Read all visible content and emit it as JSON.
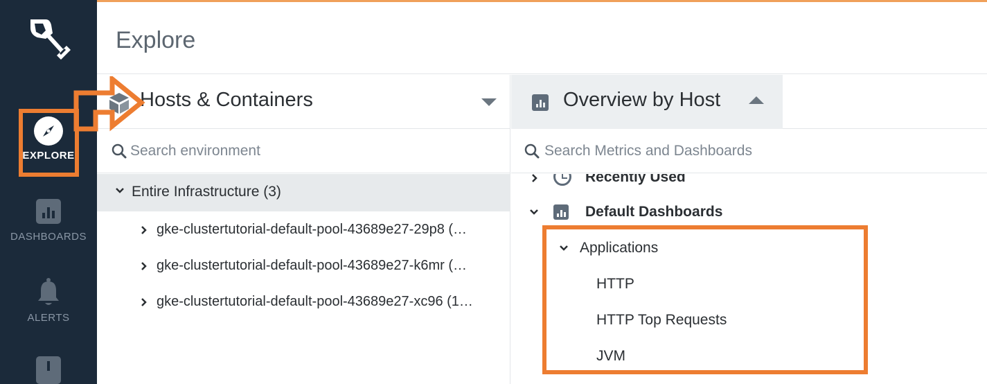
{
  "page": {
    "title": "Explore"
  },
  "sidebar": {
    "items": [
      {
        "label": "EXPLORE",
        "icon": "compass-icon",
        "active": true
      },
      {
        "label": "DASHBOARDS",
        "icon": "dashboard-icon",
        "active": false
      },
      {
        "label": "ALERTS",
        "icon": "bell-icon",
        "active": false
      },
      {
        "label": "",
        "icon": "alert-square-icon",
        "active": false
      }
    ]
  },
  "hosts_panel": {
    "title": "Hosts & Containers",
    "search_placeholder": "Search environment",
    "root": {
      "label": "Entire Infrastructure (3)"
    },
    "nodes": [
      {
        "label": "gke-clustertutorial-default-pool-43689e27-29p8 (…"
      },
      {
        "label": "gke-clustertutorial-default-pool-43689e27-k6mr (…"
      },
      {
        "label": "gke-clustertutorial-default-pool-43689e27-xc96 (1…"
      }
    ]
  },
  "dashboards_panel": {
    "title": "Overview by Host",
    "search_placeholder": "Search Metrics and Dashboards",
    "recently_used": "Recently Used",
    "default_dashboards": "Default Dashboards",
    "applications": {
      "label": "Applications",
      "items": [
        "HTTP",
        "HTTP Top Requests",
        "JVM"
      ]
    }
  },
  "colors": {
    "sidebar_bg": "#1b2a3a",
    "highlight": "#ed7d31",
    "tree_selected_bg": "#e7eaec",
    "tab_bg": "#eceff1"
  }
}
